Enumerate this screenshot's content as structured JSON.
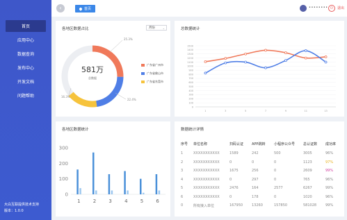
{
  "sidebar": {
    "items": [
      {
        "label": "首页",
        "active": true
      },
      {
        "label": "应用中心",
        "active": false
      },
      {
        "label": "数据查询",
        "active": false
      },
      {
        "label": "发布中心",
        "active": false
      },
      {
        "label": "开发文档",
        "active": false
      },
      {
        "label": "问题帮助",
        "active": false
      }
    ],
    "footer_company": "大白互联提供技术支持",
    "footer_version": "版本：1.0.0"
  },
  "header": {
    "breadcrumb": "首页",
    "username": "••••••••",
    "logout": "退出"
  },
  "colors": {
    "orange": "#f0795a",
    "blue": "#4f7ee6",
    "yellow": "#f6c33c",
    "sidebar": "#3e57c9",
    "active": "#2b3a8e"
  },
  "donut_panel": {
    "title": "各地区数据占比",
    "select_value": "月份",
    "center_value": "581万",
    "center_label": "总数据",
    "labels": [
      "25.3%",
      "22.4%",
      "16.3%"
    ],
    "legend": [
      "广东省广州市",
      "广东省佛山市",
      "广东省东莞市"
    ]
  },
  "line_panel": {
    "title": "总数据统计"
  },
  "bar_panel": {
    "title": "各地区数据统计"
  },
  "table_panel": {
    "title": "数据统计详情",
    "headers": [
      "序号",
      "单位名称",
      "扫码认证",
      "APP跳转",
      "小程序公众号",
      "总认证数",
      "成功率"
    ],
    "rows": [
      [
        "1",
        "XXXXXXXXXXX",
        "1589",
        "242",
        "500",
        "3005",
        "96%"
      ],
      [
        "2",
        "XXXXXXXXXXX",
        "0",
        "0",
        "0",
        "1123",
        "97%"
      ],
      [
        "3",
        "XXXXXXXXXXX",
        "1675",
        "256",
        "0",
        "2609",
        "99%"
      ],
      [
        "4",
        "XXXXXXXXXXX",
        "0",
        "297",
        "0",
        "765",
        "96%"
      ],
      [
        "5",
        "XXXXXXXXXXX",
        "2476",
        "164",
        "2577",
        "6267",
        "99%"
      ],
      [
        "6",
        "XXXXXXXXXXX",
        "0",
        "178",
        "0",
        "1020",
        "96%"
      ],
      [
        "0",
        "所有接入单位",
        "167950",
        "13260",
        "157850",
        "581028",
        "99%"
      ]
    ],
    "rate_colors": [
      "#888888",
      "#e8b21e",
      "#d23fa0",
      "#888888",
      "#888888",
      "#888888",
      "#888888"
    ]
  },
  "chart_data": [
    {
      "type": "pie",
      "title": "各地区数据占比",
      "center_value": "581万",
      "categories": [
        "广东省广州市",
        "广东省佛山市",
        "广东省东莞市"
      ],
      "values": [
        25.3,
        22.4,
        16.3
      ],
      "colors": [
        "#f0795a",
        "#4f7ee6",
        "#f6c33c"
      ]
    },
    {
      "type": "line",
      "title": "总数据统计",
      "x": [
        1,
        3,
        5,
        7,
        9,
        11,
        13
      ],
      "ylim": [
        0,
        1500
      ],
      "yticks": [
        0,
        100,
        200,
        300,
        400,
        500,
        600,
        700,
        800,
        900,
        1000,
        1100,
        1200,
        1300,
        1400,
        1500
      ],
      "series": [
        {
          "color": "#f0795a",
          "points": [
            [
              1,
              1110
            ],
            [
              3,
              1190
            ],
            [
              5,
              1300
            ],
            [
              7,
              1390
            ],
            [
              9,
              1330
            ],
            [
              11,
              1200
            ],
            [
              13,
              1230
            ]
          ]
        },
        {
          "color": "#4f7ee6",
          "points": [
            [
              1,
              830
            ],
            [
              3,
              1080
            ],
            [
              5,
              1100
            ],
            [
              7,
              960
            ],
            [
              9,
              1140
            ],
            [
              11,
              1380
            ],
            [
              13,
              1100
            ]
          ]
        }
      ]
    },
    {
      "type": "bar",
      "title": "各地区数据统计",
      "categories": [
        "1",
        "2",
        "3",
        "4",
        "5",
        "6"
      ],
      "ylim": [
        0,
        300
      ],
      "yticks": [
        0,
        100,
        200,
        300
      ],
      "series": [
        {
          "color": "#4a90d9",
          "values": [
            160,
            270,
            130,
            150,
            100,
            130
          ]
        },
        {
          "color": "#9ec8ef",
          "values": [
            40,
            25,
            25,
            25,
            10,
            25
          ]
        }
      ]
    }
  ]
}
